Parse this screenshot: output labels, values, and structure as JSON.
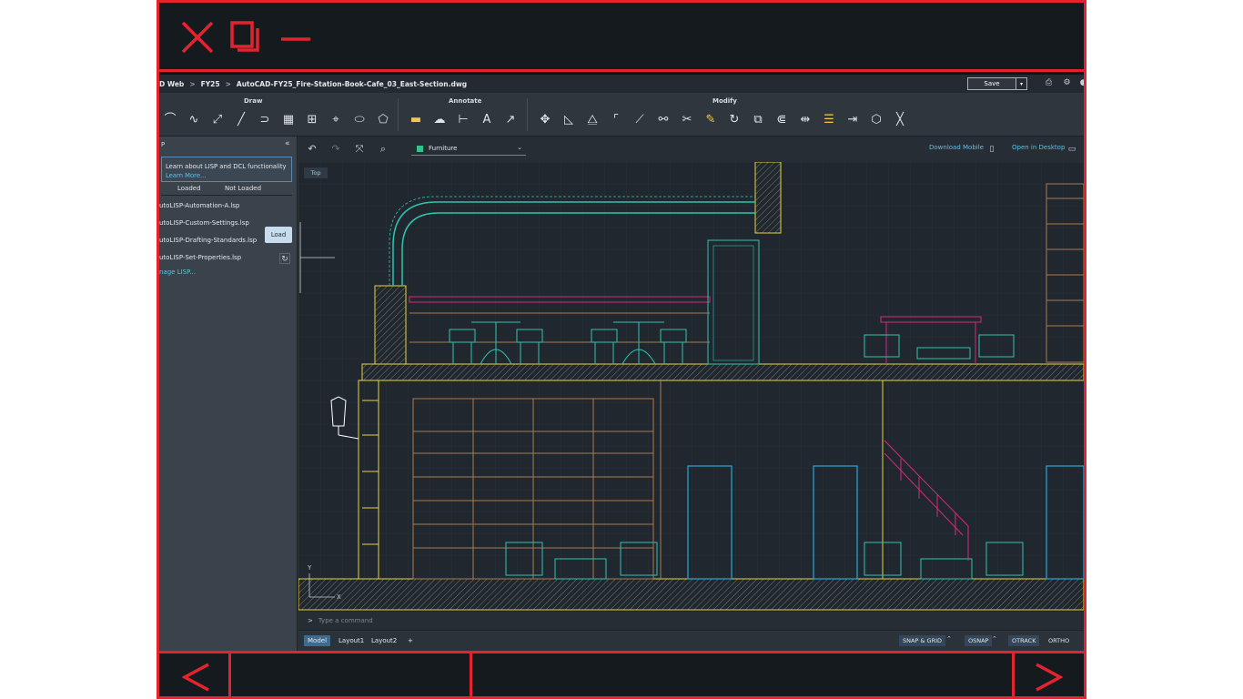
{
  "breadcrumb": [
    "D Web",
    "FY25",
    "AutoCAD-FY25_Fire-Station-Book-Cafe_03_East-Section.dwg"
  ],
  "breadcrumb_sep": ">",
  "save_label": "Save",
  "save_dropdown": "▾",
  "ribbon": {
    "draw_label": "Draw",
    "annotate_label": "Annotate",
    "modify_label": "Modify"
  },
  "panel": {
    "title": "P",
    "collapse": "«",
    "learn_text": "Learn about LISP and DCL functionality",
    "learn_link": "Learn More...",
    "tab_loaded": "Loaded",
    "tab_not_loaded": "Not Loaded",
    "items": [
      "utoLISP-Automation-A.lsp",
      "utoLISP-Custom-Settings.lsp",
      "utoLISP-Drafting-Standards.lsp",
      "utoLISP-Set-Properties.lsp"
    ],
    "load_tooltip": "Load",
    "manage_link": "nage LISP..."
  },
  "canvas_bar": {
    "layer_name": "Furniture",
    "download_mobile": "Download Mobile",
    "open_desktop": "Open in Desktop"
  },
  "drawing": {
    "view_label": "Top",
    "axis_y": "Y",
    "axis_x": "X"
  },
  "command": {
    "prompt": ">",
    "placeholder": "Type a command"
  },
  "status": {
    "tabs": [
      "Model",
      "Layout1",
      "Layout2"
    ],
    "add_tab": "+",
    "snap_grid": "SNAP & GRID",
    "osnap": "OSNAP",
    "otrack": "OTRACK",
    "ortho": "ORTHO"
  },
  "colors": {
    "frame_red": "#e3232e",
    "cad_yellow": "#e5d341",
    "cad_cyan": "#2ec4b0",
    "cad_magenta": "#d62a7a",
    "cad_blue": "#2aa7d8",
    "cad_brown": "#a87b4f"
  }
}
